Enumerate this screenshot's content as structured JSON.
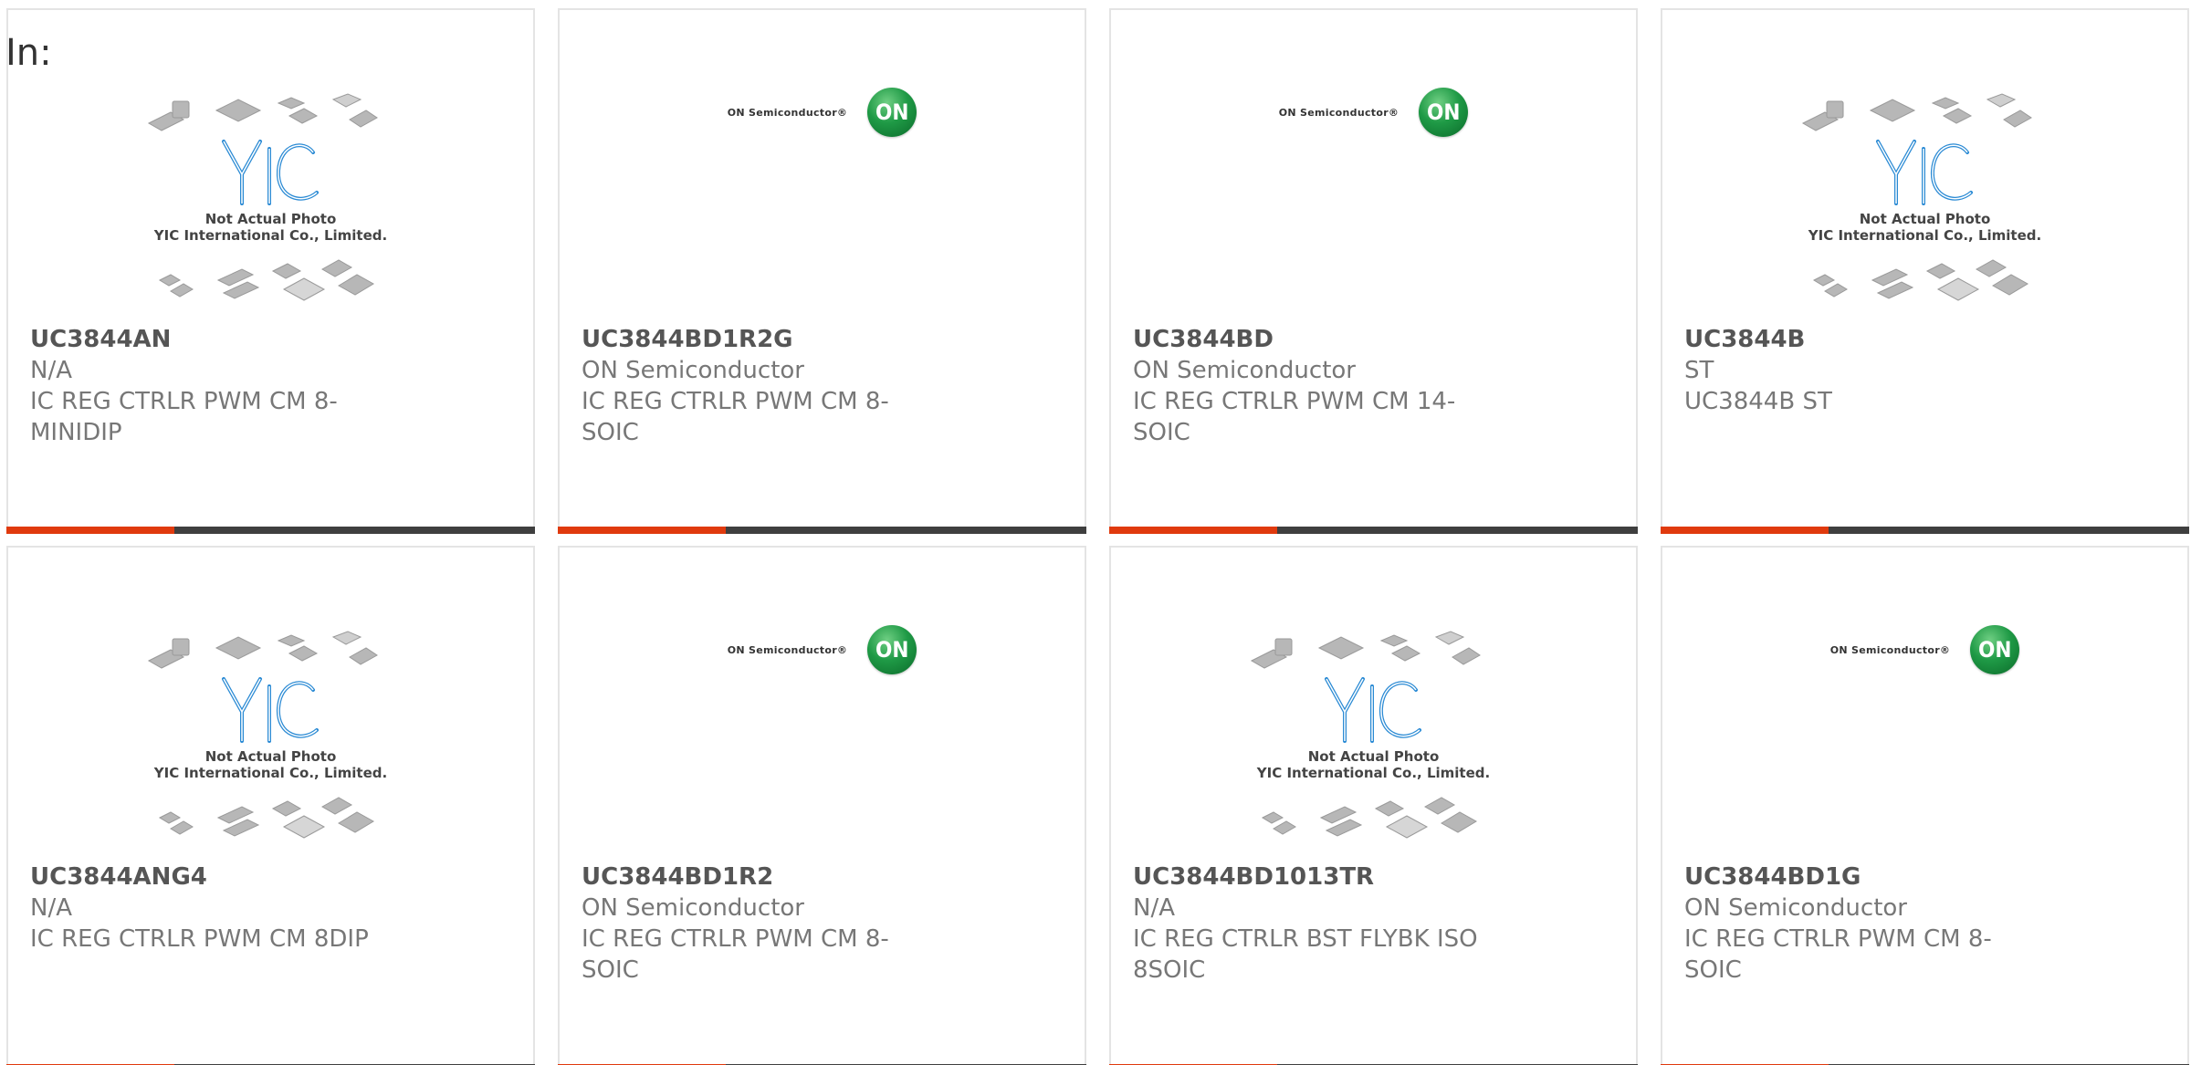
{
  "header": {
    "prefix": "In:"
  },
  "cards": [
    {
      "part": "UC3844AN",
      "manufacturer": "N/A",
      "description": "IC REG CTRLR PWM CM 8-MINIDIP",
      "photo": "yic"
    },
    {
      "part": "UC3844BD1R2G",
      "manufacturer": "ON Semiconductor",
      "description": "IC REG CTRLR PWM CM 8-SOIC",
      "photo": "on"
    },
    {
      "part": "UC3844BD",
      "manufacturer": "ON Semiconductor",
      "description": "IC REG CTRLR PWM CM 14-SOIC",
      "photo": "on"
    },
    {
      "part": "UC3844B",
      "manufacturer": "ST",
      "description": "UC3844B ST",
      "photo": "yic"
    },
    {
      "part": "UC3844ANG4",
      "manufacturer": "N/A",
      "description": "IC REG CTRLR PWM CM 8DIP",
      "photo": "yic"
    },
    {
      "part": "UC3844BD1R2",
      "manufacturer": "ON Semiconductor",
      "description": "IC REG CTRLR PWM CM 8-SOIC",
      "photo": "on"
    },
    {
      "part": "UC3844BD1013TR",
      "manufacturer": "N/A",
      "description": "IC REG CTRLR BST FLYBK ISO 8SOIC",
      "photo": "yic"
    },
    {
      "part": "UC3844BD1G",
      "manufacturer": "ON Semiconductor",
      "description": "IC REG CTRLR PWM CM 8-SOIC",
      "photo": "on"
    }
  ],
  "logos": {
    "on_text": "ON Semiconductor®",
    "on_badge": "ON",
    "yic_line1": "Not Actual Photo",
    "yic_line2": "YIC International Co., Limited."
  },
  "colors": {
    "accent": "#e03a0e",
    "bar": "#3f3f3f",
    "border": "#e4e4e4",
    "on_green": "#1f9a46",
    "yic_blue": "#2a8ad4"
  }
}
